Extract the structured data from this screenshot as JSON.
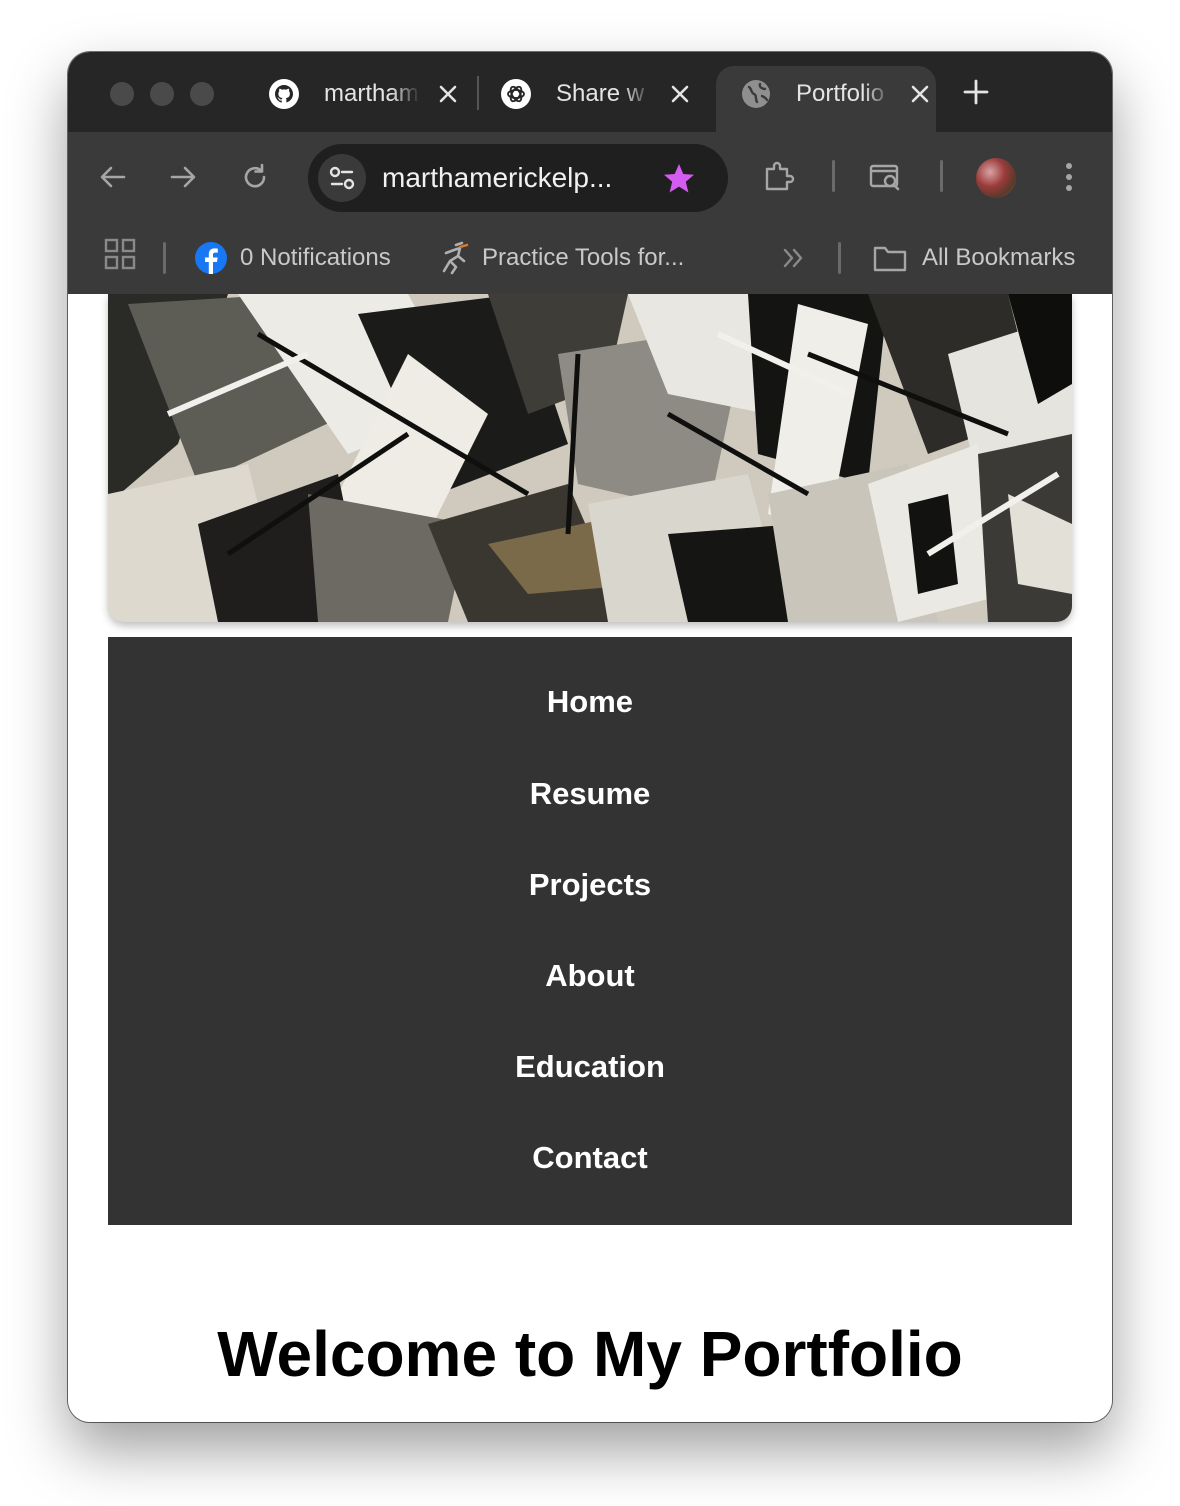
{
  "browser": {
    "tabs": [
      {
        "title": "marthamerickelp",
        "icon": "github-icon",
        "active": false
      },
      {
        "title": "Share w",
        "icon": "openai-icon",
        "active": false
      },
      {
        "title": "Portfolio",
        "icon": "globe-icon",
        "active": true
      }
    ],
    "url": "marthamerickelp...",
    "bookmarks": {
      "notifications": "0 Notifications",
      "practice_tools": "Practice Tools for...",
      "all_bookmarks": "All Bookmarks"
    },
    "colors": {
      "star": "#d45cf0",
      "frame": "#262626",
      "toolbar": "#3a3a3a"
    }
  },
  "nav": {
    "items": [
      "Home",
      "Resume",
      "Projects",
      "About",
      "Education",
      "Contact"
    ]
  },
  "main": {
    "heading": "Welcome to My Portfolio"
  }
}
